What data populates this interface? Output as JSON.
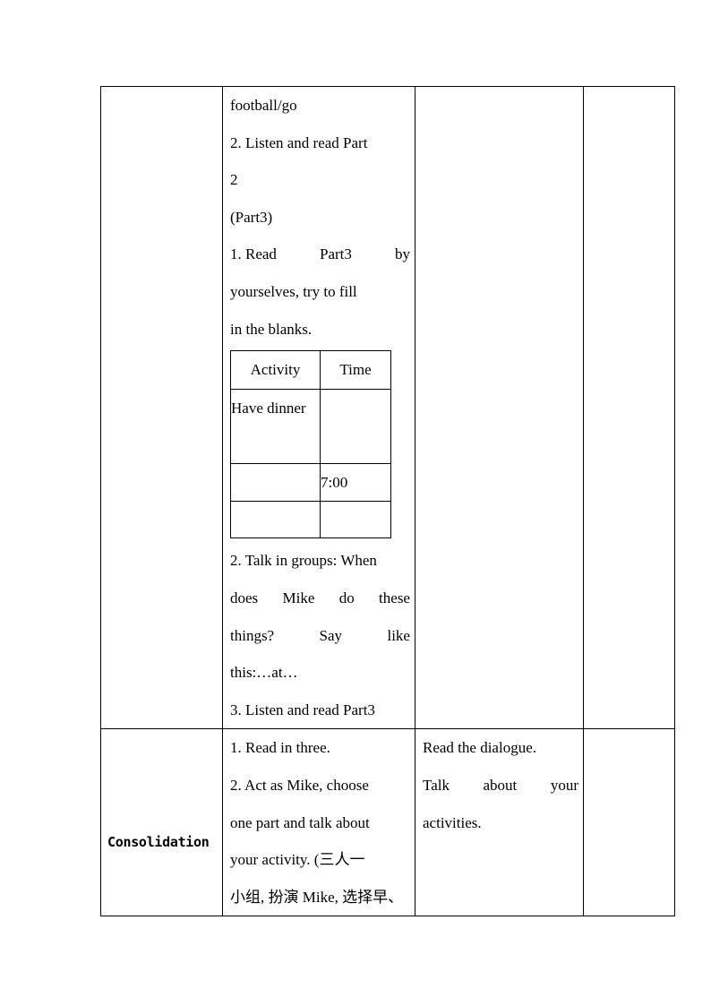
{
  "table": {
    "row1": {
      "stage": "",
      "activities_lines": [
        "football/go",
        "2. Listen and read Part",
        "2",
        "(Part3)"
      ],
      "part3_item1_words": [
        "1. Read",
        "Part3",
        "by"
      ],
      "part3_item1_lines": [
        "yourselves, try to fill",
        "in the blanks."
      ],
      "fill_table": {
        "headers": [
          "Activity",
          "Time"
        ],
        "rows": [
          [
            "Have dinner",
            ""
          ],
          [
            "",
            "7:00"
          ],
          [
            "",
            ""
          ]
        ]
      },
      "after_table": {
        "line1": "2. Talk in groups: When",
        "line2_words": [
          "does",
          "Mike",
          "do",
          "these"
        ],
        "line3_words": [
          "things?",
          "Say",
          "like"
        ],
        "line4": "this:…at…",
        "line5": "3. Listen and read Part3"
      },
      "purpose": "",
      "notes": ""
    },
    "row2": {
      "stage": "Consolidation",
      "activities_lines": [
        "1. Read in three.",
        "2. Act as Mike, choose",
        "one part and talk about",
        "your activity. (三人一",
        "小组, 扮演 Mike, 选择早、"
      ],
      "purpose_line1": "Read the dialogue.",
      "purpose_line2_words": [
        "Talk",
        "about",
        "your"
      ],
      "purpose_line3": "activities.",
      "notes": ""
    }
  }
}
